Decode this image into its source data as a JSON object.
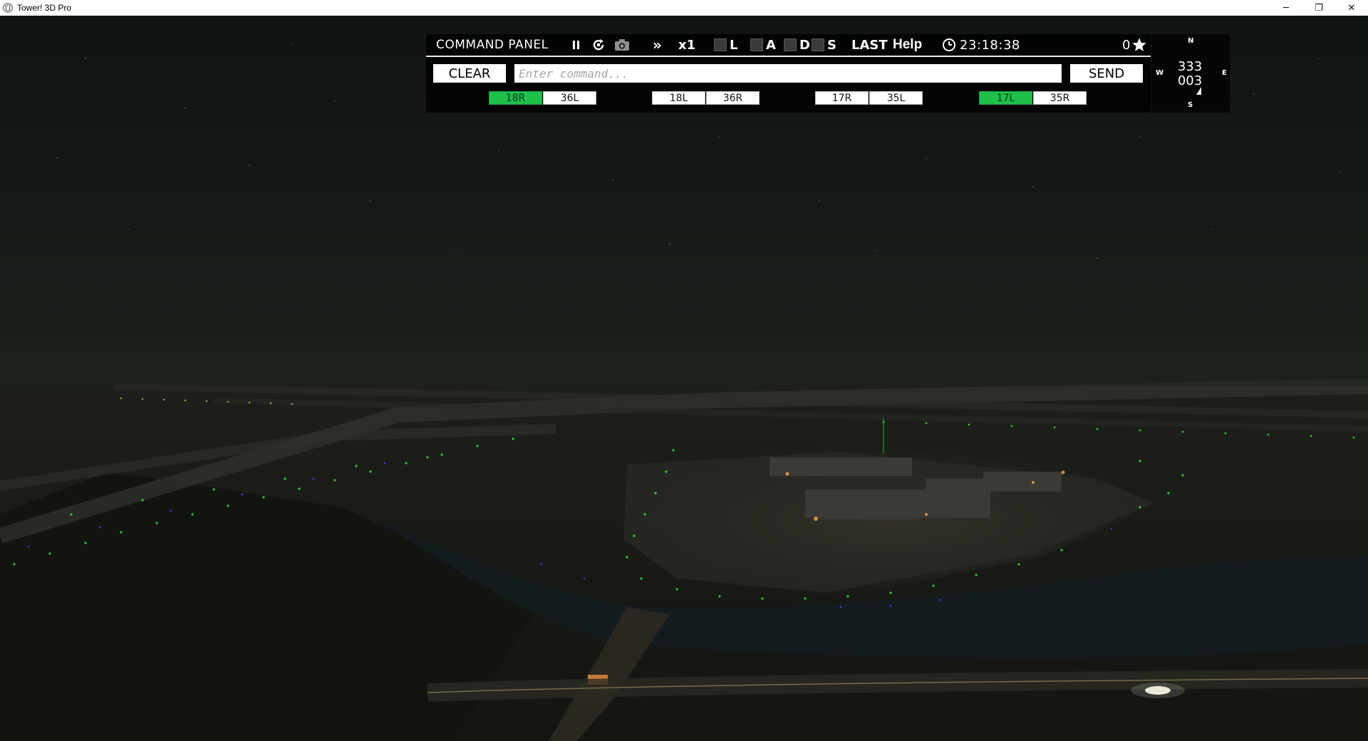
{
  "window": {
    "title": "Tower! 3D Pro",
    "controls": {
      "minimize": "─",
      "restore": "❐",
      "close": "✕"
    }
  },
  "command_panel": {
    "title": "COMMAND PANEL",
    "icons": {
      "pause": "pause-icon",
      "reset": "reset-icon",
      "camera": "camera-icon",
      "fast_forward": "fast-forward-icon",
      "clock": "clock-icon",
      "star": "star-icon"
    },
    "fast_forward_glyph": "»",
    "speed": "x1",
    "filters": [
      {
        "label": "L",
        "checked": false
      },
      {
        "label": "A",
        "checked": false
      },
      {
        "label": "D",
        "checked": false
      },
      {
        "label": "S",
        "checked": false
      }
    ],
    "last_label": "LAST",
    "help_label": "Help",
    "clock_time": "23:18:38",
    "star_count": "0",
    "clear_label": "CLEAR",
    "send_label": "SEND",
    "command_placeholder": "Enter command...",
    "runways": [
      {
        "label": "18R",
        "active": true
      },
      {
        "label": "36L",
        "active": false
      },
      {
        "label": "18L",
        "active": false
      },
      {
        "label": "36R",
        "active": false
      },
      {
        "label": "17R",
        "active": false
      },
      {
        "label": "35L",
        "active": false
      },
      {
        "label": "17L",
        "active": true
      },
      {
        "label": "35R",
        "active": false
      }
    ],
    "colors": {
      "runway_active": "#1fc04a",
      "panel_bg": "#000000"
    }
  },
  "compass": {
    "north": "N",
    "south": "S",
    "east": "E",
    "west": "W",
    "heading_primary": "333",
    "heading_secondary": "003"
  }
}
